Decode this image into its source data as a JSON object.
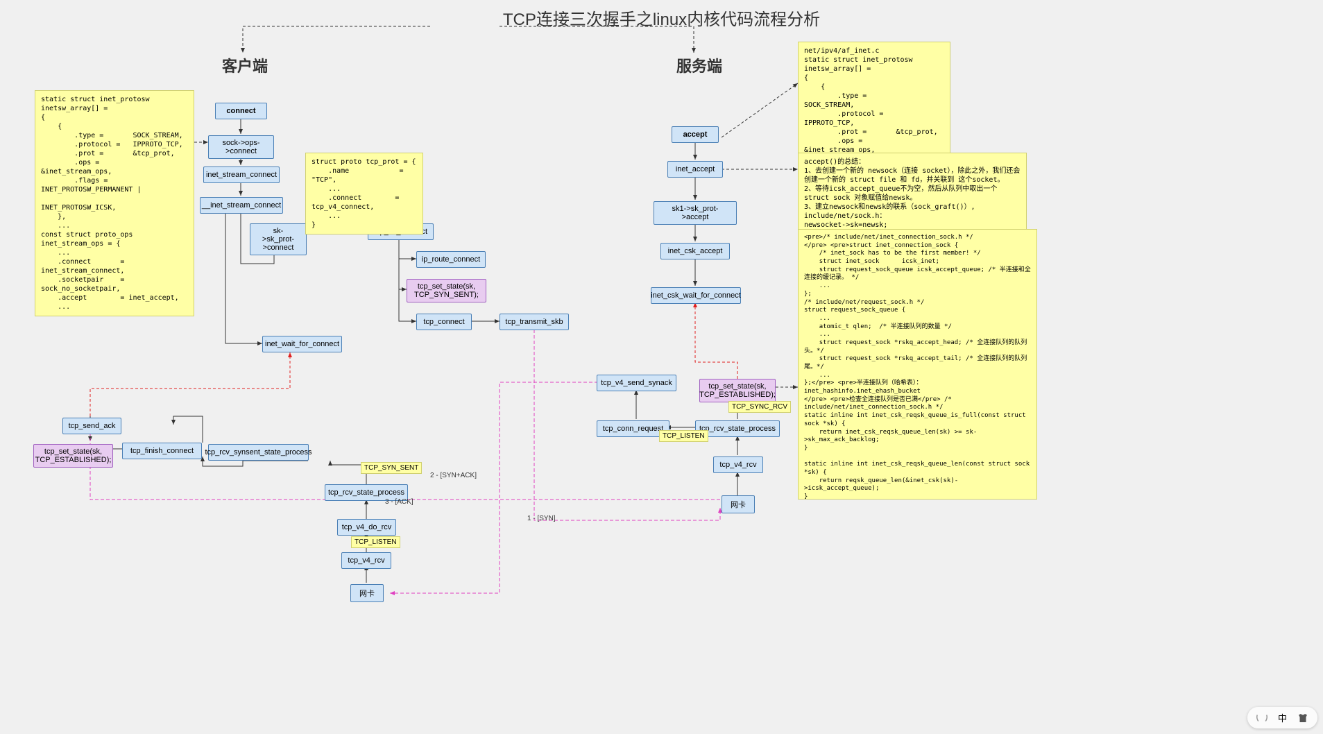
{
  "title": "TCP连接三次握手之linux内核代码流程分析",
  "client_label": "客户端",
  "server_label": "服务端",
  "client": {
    "connect": "connect",
    "sock_ops_connect": "sock->ops->connect",
    "inet_stream_connect": "inet_stream_connect",
    "__inet_stream_connect": "__inet_stream_connect",
    "sk_sk_prot_connect": "sk->sk_prot->connect",
    "tcp_v4_connect": "tcp_v4_connect",
    "ip_route_connect": "ip_route_connect",
    "tcp_set_state_syn_sent": "tcp_set_state(sk,\nTCP_SYN_SENT);",
    "tcp_connect": "tcp_connect",
    "tcp_transmit_skb": "tcp_transmit_skb",
    "inet_wait_for_connect": "inet_wait_for_connect",
    "tcp_send_ack": "tcp_send_ack",
    "tcp_finish_connect": "tcp_finish_connect",
    "tcp_set_state_established": "tcp_set_state(sk,\nTCP_ESTABLISHED);",
    "tcp_rcv_synsent_state_process": "tcp_rcv_synsent_state_process",
    "tcp_rcv_state_process": "tcp_rcv_state_process",
    "tcp_v4_do_rcv": "tcp_v4_do_rcv",
    "tcp_v4_rcv": "tcp_v4_rcv",
    "nic": "网卡"
  },
  "server": {
    "accept": "accept",
    "inet_accept": "inet_accept",
    "sk1_sk_prot_accept": "sk1->sk_prot->accept",
    "inet_csk_accept": "inet_csk_accept",
    "inet_csk_wait_for_connect": "inet_csk_wait_for_connect",
    "tcp_v4_send_synack": "tcp_v4_send_synack",
    "tcp_set_state_established": "tcp_set_state(sk,\nTCP_ESTABLISHED);",
    "tcp_conn_request": "tcp_conn_request",
    "tcp_rcv_state_process": "tcp_rcv_state_process",
    "tcp_v4_rcv": "tcp_v4_rcv",
    "nic": "网卡"
  },
  "edge_labels": {
    "syn": "1 - [SYN]",
    "syn_ack": "2 - [SYN+ACK]",
    "ack": "3 - [ACK]",
    "tcp_syn_sent": "TCP_SYN_SENT",
    "tcp_listen_client": "TCP_LISTEN",
    "tcp_listen_server": "TCP_LISTEN",
    "tcp_sync_rcv": "TCP_SYNC_RCV"
  },
  "notes": {
    "inetsw_array_client": "static struct inet_protosw inetsw_array[] =\n{\n    {\n        .type =       SOCK_STREAM,\n        .protocol =   IPPROTO_TCP,\n        .prot =       &tcp_prot,\n        .ops =        &inet_stream_ops,\n        .flags =      INET_PROTOSW_PERMANENT |\n                  INET_PROTOSW_ICSK,\n    },\n    ...\nconst struct proto_ops inet_stream_ops = {\n    ...\n    .connect       = inet_stream_connect,\n    .socketpair    = sock_no_socketpair,\n    .accept        = inet_accept,\n    ...",
    "tcp_prot": "struct proto tcp_prot = {\n    .name            = \"TCP\",\n    ...\n    .connect        = tcp_v4_connect,\n    ...\n}",
    "inetsw_array_server": "net/ipv4/af_inet.c\nstatic struct inet_protosw inetsw_array[] =\n{\n    {\n        .type =       SOCK_STREAM,\n        .protocol =   IPPROTO_TCP,\n        .prot =       &tcp_prot,\n        .ops =        &inet_stream_ops,\n        .flags =      INET_PROTOSW_PERMANENT |\n                  INET_PROTOSW_ICSK,\n    ...\nconst struct proto_ops inet_stream_ops = {\n    ...\n    .listen        = inet_accept,\n    ...\n}",
    "accept_summary": "accept()的总结：\n1、去创建一个新的 newsock（连接 socket），除此之外，我们还会创建一个新的 struct file 和 fd，并关联到 这个socket。\n2、等待icsk_accept_queue不为空，然后从队列中取出一个 struct sock 对象赋值给newsk。\n3、建立newsock和newsk的联系（sock_graft()）, include/net/sock.h：\nnewsocket->sk=newsk;\nnewsk->sk_socket = newsock;\n什么情况下，icsk_accept_queue 才不为空呢？当然是三次握手结束才可以。",
    "request_sock": "<pre>/* include/net/inet_connection_sock.h */\n</pre> <pre>struct inet_connection_sock {\n    /* inet_sock has to be the first member! */\n    struct inet_sock      icsk_inet;\n    struct request_sock_queue icsk_accept_queue; /* 半连接和全连接的缓记录。 */\n    ...\n};\n/* include/net/request_sock.h */\nstruct request_sock_queue {\n    ...\n    atomic_t qlen;  /* 半连接队列的数量 */\n    ...\n    struct request_sock *rskq_accept_head; /* 全连接队列的队列头。*/\n    struct request_sock *rskq_accept_tail; /* 全连接队列的队列尾。*/\n    ...\n};</pre> <pre>半连接队列（哈希表）：inet_hashinfo.inet_ehash_bucket\n</pre> <pre>检查全连接队列是否已满</pre> /* include/net/inet_connection_sock.h */\nstatic inline int inet_csk_reqsk_queue_is_full(const struct sock *sk) {\n    return inet_csk_reqsk_queue_len(sk) >= sk->sk_max_ack_backlog;\n}\n\nstatic inline int inet_csk_reqsk_queue_len(const struct sock *sk) {\n    return reqsk_queue_len(&inet_csk(sk)->icsk_accept_queue);\n}\n\nstatic inline int reqsk_queue_len(const struct request_sock_queue *queue) {\n    return atomic_read(&queue->qlen);\n}\n</pre>\n<pre>检查半连接队列是否已满</pre>\n<pre>static inline bool sk_acceptq_is_full(const struct sock *sk) {\n    return sk->sk_ack_backlog > sk->sk_max_ack_backlog;\n}\n...\n</pre> <pre>【总结】</pre> <pre>accept从request_sock_queue队列的头部rskq_accept_head\n取出一个request_sock,</pre> <pre>进而取出strut sock结构，并和struct socket建立联系。</pre>"
  },
  "toolbar": {
    "lang": "中"
  }
}
